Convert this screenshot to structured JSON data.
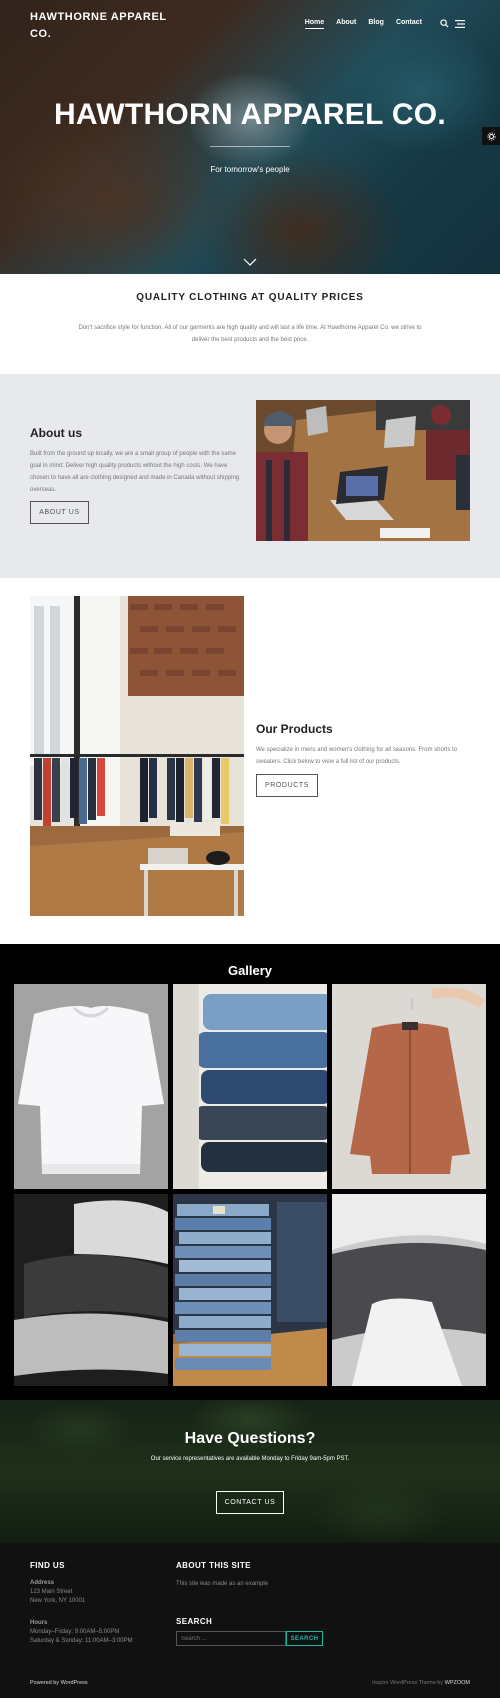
{
  "header": {
    "logo": "HAWTHORNE APPAREL CO.",
    "nav": [
      {
        "label": "Home",
        "active": true
      },
      {
        "label": "About"
      },
      {
        "label": "Blog"
      },
      {
        "label": "Contact"
      }
    ]
  },
  "hero": {
    "title": "HAWTHORN APPAREL CO.",
    "subtitle": "For tomorrow's people"
  },
  "intro": {
    "heading": "QUALITY CLOTHING AT QUALITY PRICES",
    "text": "Don't sacrifice style for function. All of our garments are high quality and will last a life time. At Hawthorne Apparel Co. we strive to deliver the best products and the best price."
  },
  "about": {
    "heading": "About us",
    "text": "Built from the ground up locally, we are a small group of people with the same goal in mind: Deliver high quality products without the high costs. We have chosen to have all are clothing designed and made in Canada without shipping overseas.",
    "button": "ABOUT US"
  },
  "products": {
    "heading": "Our Products",
    "text": "We specialize in mens and women's clothing for all seasons. From shorts to sweaters. Click below to view a full list of our products.",
    "button": "PRODUCTS"
  },
  "gallery": {
    "heading": "Gallery"
  },
  "cta": {
    "heading": "Have Questions?",
    "text": "Our service representatives are available Monday to Friday 9am-5pm PST.",
    "button": "CONTACT US"
  },
  "footer": {
    "find_us": {
      "heading": "FIND US",
      "address_label": "Address",
      "address_line1": "123 Main Street",
      "address_line2": "New York, NY 10001",
      "hours_label": "Hours",
      "hours_line1": "Monday–Friday: 9:00AM–5:00PM",
      "hours_line2": "Saturday & Sunday: 11:00AM–3:00PM"
    },
    "about_site": {
      "heading": "ABOUT THIS SITE",
      "text": "This site was made as an example"
    },
    "search": {
      "heading": "SEARCH",
      "placeholder": "Search ...",
      "button": "SEARCH"
    },
    "powered_by": "Powered by WordPress",
    "theme_credit_prefix": "Inspiro WordPress Theme by",
    "theme_credit_brand": "WPZOOM"
  },
  "colors": {
    "accent": "#1fb6a6",
    "about_bg": "#e7e9ec",
    "footer_bg": "#111111"
  }
}
